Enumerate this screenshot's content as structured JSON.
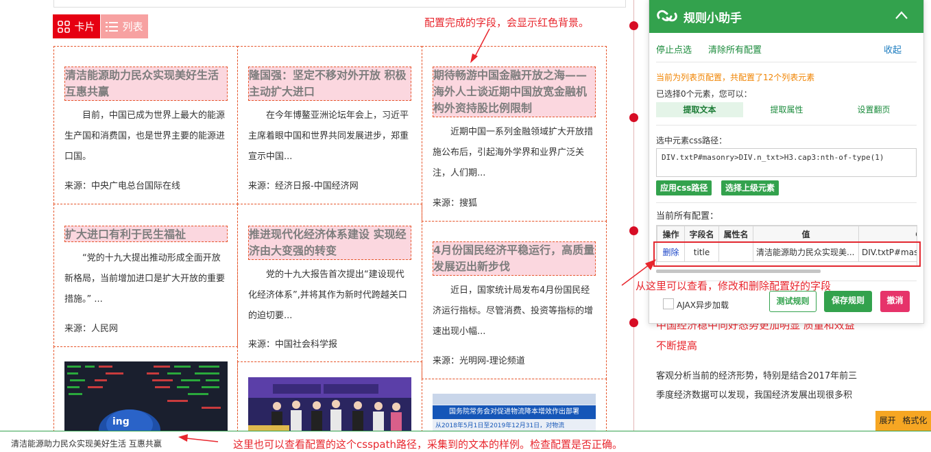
{
  "view_toggle": {
    "card_label": "卡片",
    "list_label": "列表"
  },
  "annotations": {
    "top": "配置完成的字段，会显示红色背景。",
    "right": "从这里可以查看，修改和删除配置好的字段",
    "bottom": "这里也可以查看配置的这个csspath路径，采集到的文本的样例。检查配置是否正确。"
  },
  "articles": {
    "a1": {
      "title": "清洁能源助力民众实现美好生活 互惠共赢",
      "text": "目前，中国已成为世界上最大的能源生产国和消费国，也是世界主要的能源进口国。",
      "source": "来源：中央广电总台国际在线"
    },
    "a2": {
      "title": "隆国强：坚定不移对外开放 积极主动扩大进口",
      "text": "在今年博鳌亚洲论坛年会上，习近平主席着眼中国和世界共同发展进步，郑重宣示中国...",
      "source": "来源：经济日报-中国经济网"
    },
    "a3": {
      "title": "期待畅游中国金融开放之海——海外人士谈近期中国放宽金融机构外资持股比例限制",
      "text": "近期中国一系列金融领域扩大开放措施公布后，引起海外学界和业界广泛关注，人们期...",
      "source": "来源：搜狐"
    },
    "a4": {
      "title": "扩大进口有利于民生福祉",
      "text": "“党的十九大提出推动形成全面开放新格局，当前增加进口是扩大开放的重要措施。” ...",
      "source": "来源：人民网"
    },
    "a5": {
      "title": "推进现代化经济体系建设 实现经济由大变强的转变",
      "text": "党的十九大报告首次提出“建设现代化经济体系”,并将其作为新时代跨越关口的迫切要...",
      "source": "来源：中国社会科学报"
    },
    "a6": {
      "title": "4月份国民经济平稳运行，高质量发展迈出新步伐",
      "text": "近日，国家统计局发布4月份国民经济运行指标。尽管消费、投资等指标的增速出现小幅...",
      "source": "来源：光明网-理论频道"
    }
  },
  "image_texts": {
    "a9_banner": "国务院常务会对促进物流降本增效作出部署",
    "a9_sub": "从2018年5月1日至2019年12月31日，对物流"
  },
  "background_article": {
    "title_line1": "中国经济稳中向好态势更加明显 质量和效益",
    "title_line2": "不断提高",
    "body_line1": "客观分析当前的经济形势，特别是结合2017年前三",
    "body_line2": "季度经济数据可以发现，我国经济发展出现很多积"
  },
  "panel": {
    "title": "规则小助手",
    "stop_pick": "停止点选",
    "clear_all": "清除所有配置",
    "collapse": "收起",
    "status": "当前为列表页配置，共配置了12个列表元素",
    "selected": "已选择0个元素，您可以：",
    "options": [
      "提取文本",
      "提取属性",
      "设置翻页"
    ],
    "css_label": "选中元素css路径：",
    "css_value": "DIV.txtP#masonry>DIV.n_txt>H3.cap3:nth-of-type(1)",
    "apply_css": "应用css路径",
    "select_parent": "选择上级元素",
    "configs_label": "当前所有配置：",
    "table_headers": [
      "操作",
      "字段名",
      "属性名",
      "值",
      "CSS路"
    ],
    "table_row": {
      "action": "删除",
      "field": "title",
      "attr": "",
      "value": "清洁能源助力民众实现美...",
      "css": "DIV.txtP#masc"
    },
    "ajax_label": "AJAX异步加载",
    "test_rule": "测试规则",
    "save_rule": "保存规则",
    "cancel": "撤消"
  },
  "format_bar": {
    "expand": "展开",
    "format": "格式化"
  },
  "bottom_preview": "清洁能源助力民众实现美好生活 互惠共赢",
  "colors": {
    "accent_red": "#e60012",
    "panel_green": "#33a24d",
    "annotation_red": "#e8262d",
    "cancel_pink": "#e6336a",
    "format_orange": "#f6a623"
  }
}
